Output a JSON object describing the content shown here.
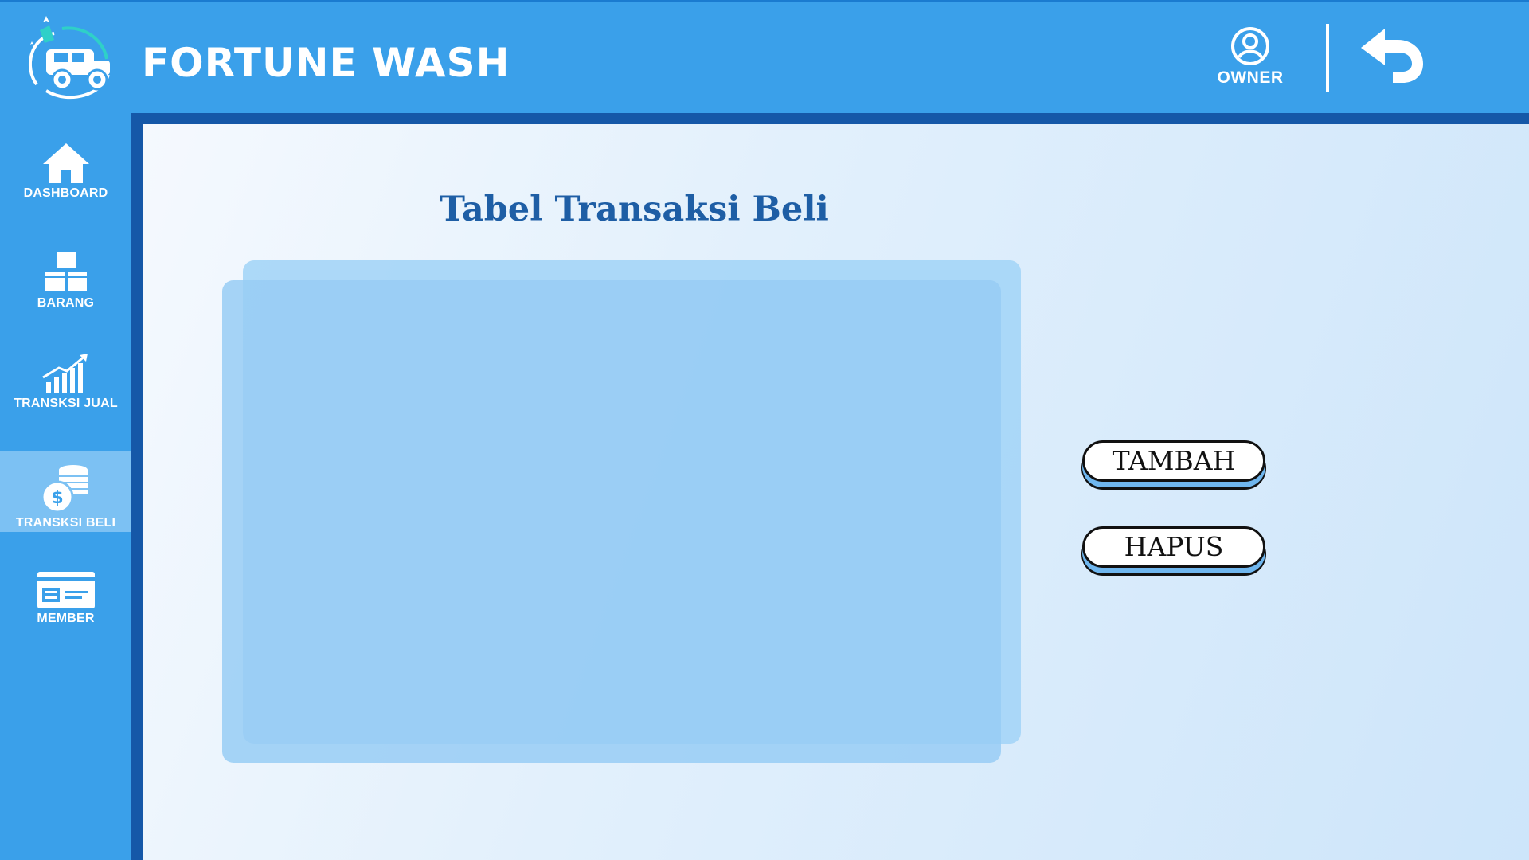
{
  "header": {
    "app_title": "FORTUNE WASH",
    "user_label": "OWNER",
    "logo_icon": "car-wash-logo-icon",
    "user_icon": "user-circle-icon",
    "back_icon": "back-arrow-icon"
  },
  "sidebar": {
    "active_index": 3,
    "items": [
      {
        "label": "DASHBOARD",
        "icon": "home-icon"
      },
      {
        "label": "BARANG",
        "icon": "boxes-icon"
      },
      {
        "label": "TRANSKSI JUAL",
        "icon": "growth-chart-icon"
      },
      {
        "label": "TRANSKSI BELI",
        "icon": "coins-dollar-icon"
      },
      {
        "label": "MEMBER",
        "icon": "member-card-icon"
      }
    ]
  },
  "main": {
    "page_title": "Tabel Transaksi Beli",
    "buttons": {
      "add_label": "TAMBAH",
      "delete_label": "HAPUS"
    }
  },
  "colors": {
    "header_bg": "#3aa0ea",
    "sidebar_active": "#7cc1f3",
    "frame_border": "#1558a8",
    "title_color": "#1e5ea5",
    "panel_color": "#98cdf5"
  }
}
